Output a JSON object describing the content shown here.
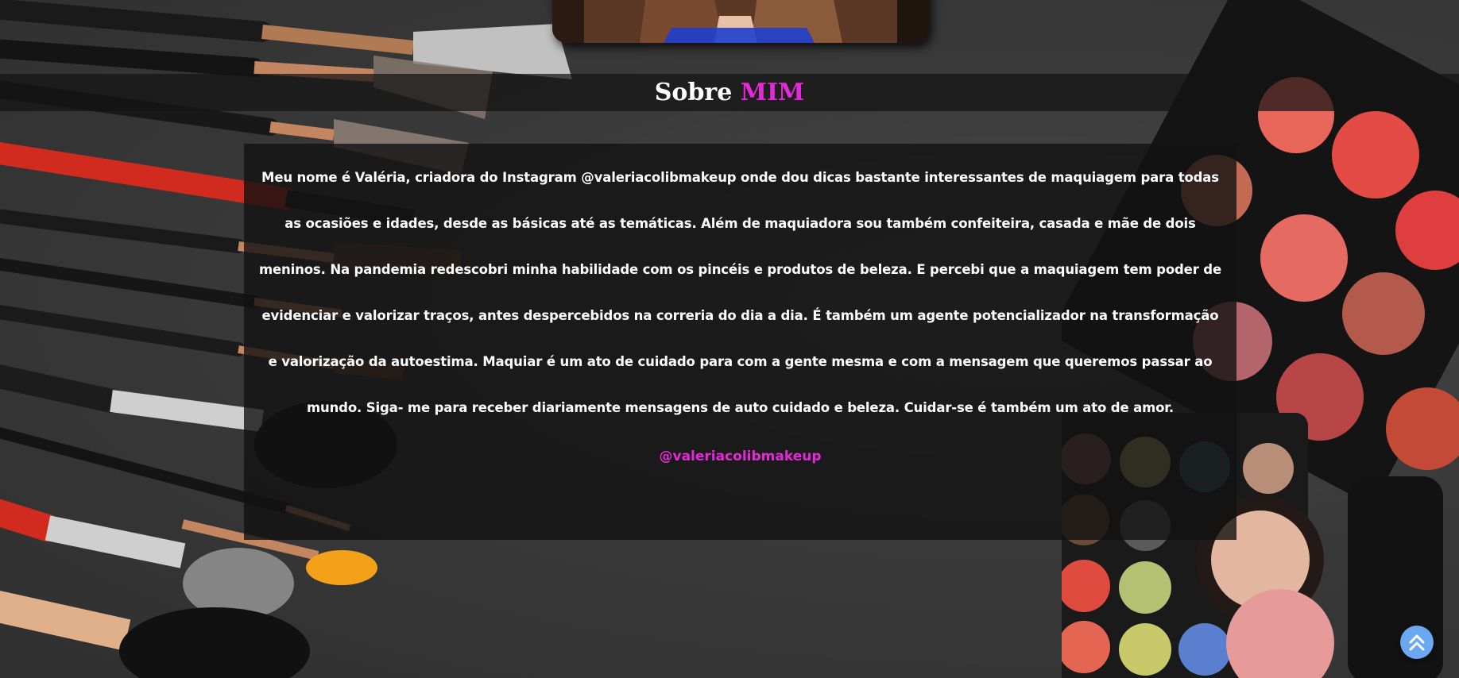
{
  "about": {
    "title": "Sobre",
    "title_accent": "MIM",
    "paragraph": "Meu nome é Valéria, criadora do Instagram @valeriacolibmakeup onde dou dicas bastante interessantes de maquiagem para todas as ocasiões e idades, desde as básicas até as temáticas. Além de maquiadora sou também confeiteira, casada e mãe de dois meninos. Na pandemia redescobri minha habilidade com os pincéis e produtos de beleza. E percebi que a maquiagem tem poder de evidenciar e valorizar traços, antes despercebidos na correria do dia a dia. É também um agente potencializador na transformação e valorização da autoestima. Maquiar é um ato de cuidado para com a gente mesma e com a mensagem que queremos passar ao mundo. Siga- me para receber diariamente mensagens de auto cuidado e beleza. Cuidar-se é também um ato de amor.",
    "instagram_handle": "@valeriacolibmakeup"
  },
  "back_to_top": {
    "icon": "double-chevron-up-icon"
  },
  "colors": {
    "accent": "#e42ad8",
    "back_to_top_bg": "#6aa8f2",
    "band_bg": "#141414",
    "text": "#ffffff"
  }
}
